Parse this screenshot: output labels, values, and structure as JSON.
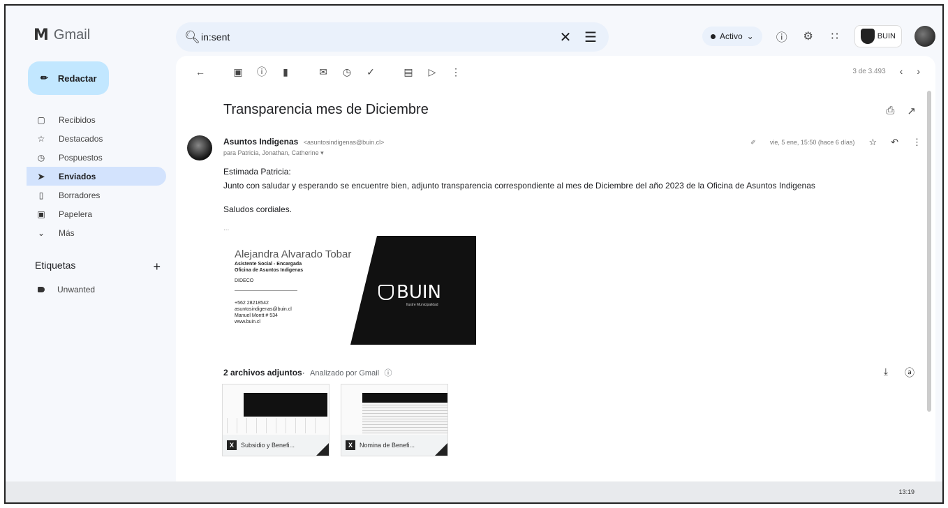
{
  "app": {
    "name": "Gmail"
  },
  "search": {
    "value": "in:sent"
  },
  "header": {
    "status": "Activo",
    "org_label": "BUIN"
  },
  "compose": {
    "label": "Redactar"
  },
  "sidebar": {
    "items": [
      {
        "label": "Recibidos",
        "icon": "inbox-icon"
      },
      {
        "label": "Destacados",
        "icon": "star-icon"
      },
      {
        "label": "Pospuestos",
        "icon": "clock-icon"
      },
      {
        "label": "Enviados",
        "icon": "send-icon",
        "active": true
      },
      {
        "label": "Borradores",
        "icon": "draft-icon"
      },
      {
        "label": "Papelera",
        "icon": "trash-icon"
      },
      {
        "label": "Más",
        "icon": "chevron-down-icon"
      }
    ],
    "labels_heading": "Etiquetas",
    "labels": [
      {
        "label": "Unwanted"
      }
    ]
  },
  "toolbar": {
    "pager": "3 de 3.493"
  },
  "email": {
    "subject": "Transparencia mes de Diciembre",
    "sender_name": "Asuntos Indigenas",
    "sender_email": "<asuntosindigenas@buin.cl>",
    "to": "para Patricia, Jonathan, Catherine",
    "date": "vie, 5 ene, 15:50 (hace 6 días)",
    "greeting": "Estimada Patricia:",
    "body": "Junto con saludar y esperando se encuentre bien, adjunto transparencia correspondiente al mes de Diciembre del año 2023 de la Oficina de Asuntos Indigenas",
    "closing": "Saludos cordiales.",
    "ellipsis": "..."
  },
  "signature": {
    "name": "Alejandra Alvarado Tobar",
    "role1": "Asistente Social - Encargada",
    "role2": "Oficina de Asuntos Indigenas",
    "dept": "DIDECO",
    "phone": "+562 28218542",
    "email": "asuntosindigenas@buin.cl",
    "address": "Manuel Montt # 534",
    "web": "www.buin.cl",
    "logo_text": "BUIN",
    "logo_sub": "Ilustre Municipalidad"
  },
  "attachments": {
    "heading": "2 archivos adjuntos",
    "scanned": "Analizado por Gmail",
    "files": [
      {
        "name": "Subsidio y Benefi..."
      },
      {
        "name": "Nomina de Benefi..."
      }
    ]
  },
  "taskbar": {
    "time": "13:19"
  }
}
